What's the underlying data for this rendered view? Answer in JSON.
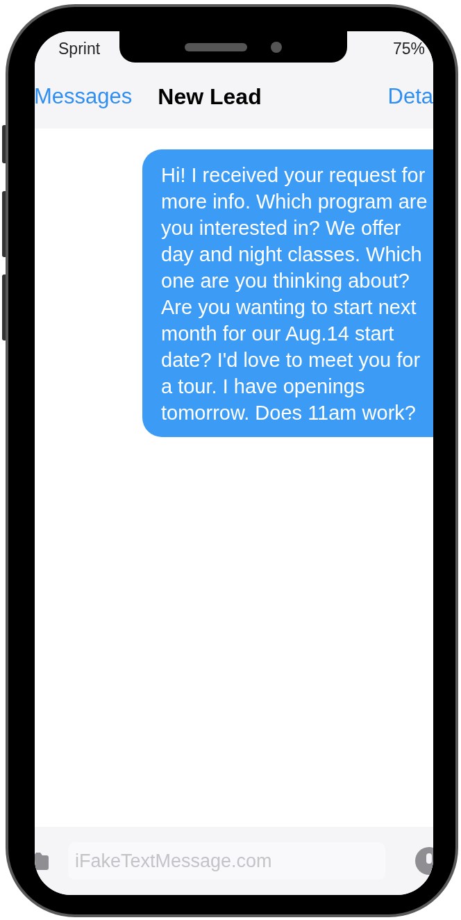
{
  "status_bar": {
    "carrier": "Sprint",
    "battery": "75%"
  },
  "nav": {
    "back": "Messages",
    "title": "New Lead",
    "action": "Deta"
  },
  "messages": [
    {
      "kind": "sent",
      "text": "Hi! I received your request for more info. Which program are you interested in? We offer day and night classes. Which one are you thinking about? Are you wanting to start next month for our Aug.14 start date? I'd love to meet you for a tour. I have openings tomorrow. Does 11am work?"
    }
  ],
  "composer": {
    "placeholder": "iFakeTextMessage.com"
  }
}
